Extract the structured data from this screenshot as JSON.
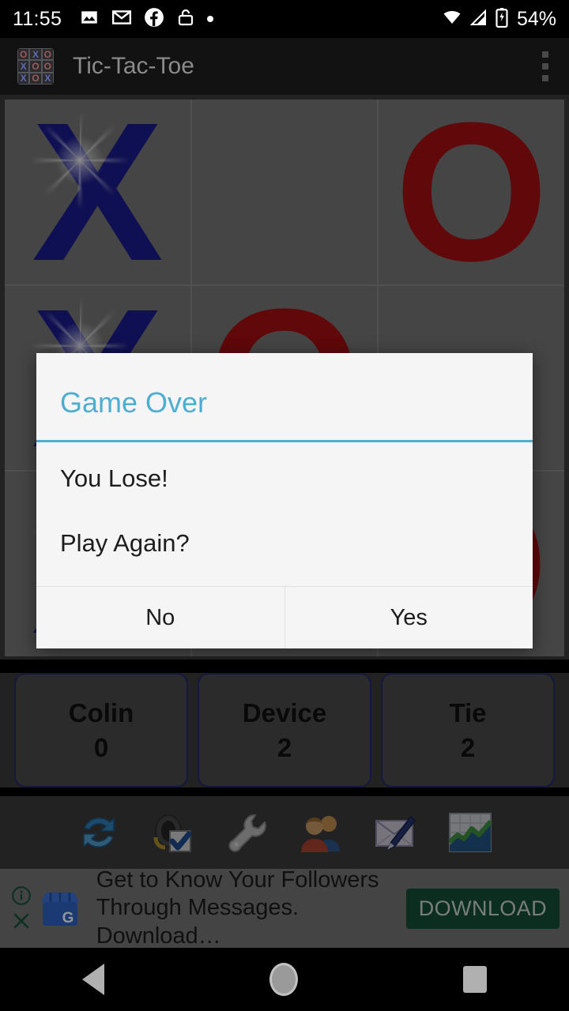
{
  "status_bar": {
    "time": "11:55",
    "left_icons": [
      "photos-icon",
      "gmail-icon",
      "facebook-icon",
      "unlock-icon",
      "dot-icon"
    ],
    "right_icons": [
      "wifi-icon",
      "cellular-signal-icon",
      "battery-charging-icon"
    ],
    "battery_text": "54%"
  },
  "app_bar": {
    "title": "Tic-Tac-Toe",
    "icon": "tic-tac-toe-app-icon",
    "icon_grid": [
      "O",
      "X",
      "O",
      "X",
      "O",
      "O",
      "X",
      "O",
      "X"
    ],
    "overflow_icon": "overflow-menu-icon"
  },
  "board": {
    "cells": [
      {
        "mark": "X",
        "winning": true
      },
      {
        "mark": "",
        "winning": false
      },
      {
        "mark": "O",
        "winning": false
      },
      {
        "mark": "X",
        "winning": true
      },
      {
        "mark": "O",
        "winning": false
      },
      {
        "mark": "",
        "winning": false
      },
      {
        "mark": "X",
        "winning": true
      },
      {
        "mark": "",
        "winning": false
      },
      {
        "mark": "O",
        "winning": false
      }
    ],
    "x_color": "#1b1b8f",
    "o_color": "#a50f12",
    "cell_color": "#787878"
  },
  "scores": [
    {
      "name": "Colin",
      "value": "0"
    },
    {
      "name": "Device",
      "value": "2"
    },
    {
      "name": "Tie",
      "value": "2"
    }
  ],
  "toolbar": {
    "icons": [
      {
        "name": "refresh-icon",
        "label": "New Game"
      },
      {
        "name": "sound-check-icon",
        "label": "Sound"
      },
      {
        "name": "wrench-icon",
        "label": "Settings"
      },
      {
        "name": "friends-icon",
        "label": "Friends"
      },
      {
        "name": "compose-mail-icon",
        "label": "Feedback"
      },
      {
        "name": "stats-chart-icon",
        "label": "Statistics"
      }
    ]
  },
  "ad": {
    "info_icon": "ad-info-icon",
    "close_icon": "ad-close-icon",
    "advertiser_icon": "google-my-business-icon",
    "line1": "Get to Know Your Followers",
    "line2": "Through Messages. Download…",
    "cta_label": "DOWNLOAD",
    "cta_color": "#15503a"
  },
  "dialog": {
    "title": "Game Over",
    "accent_color": "#4fadd2",
    "message_line1": "You Lose!",
    "message_line2": "Play Again?",
    "negative_button": "No",
    "positive_button": "Yes"
  },
  "nav_bar": {
    "back": "back-nav-icon",
    "home": "home-nav-icon",
    "recents": "recents-nav-icon"
  }
}
